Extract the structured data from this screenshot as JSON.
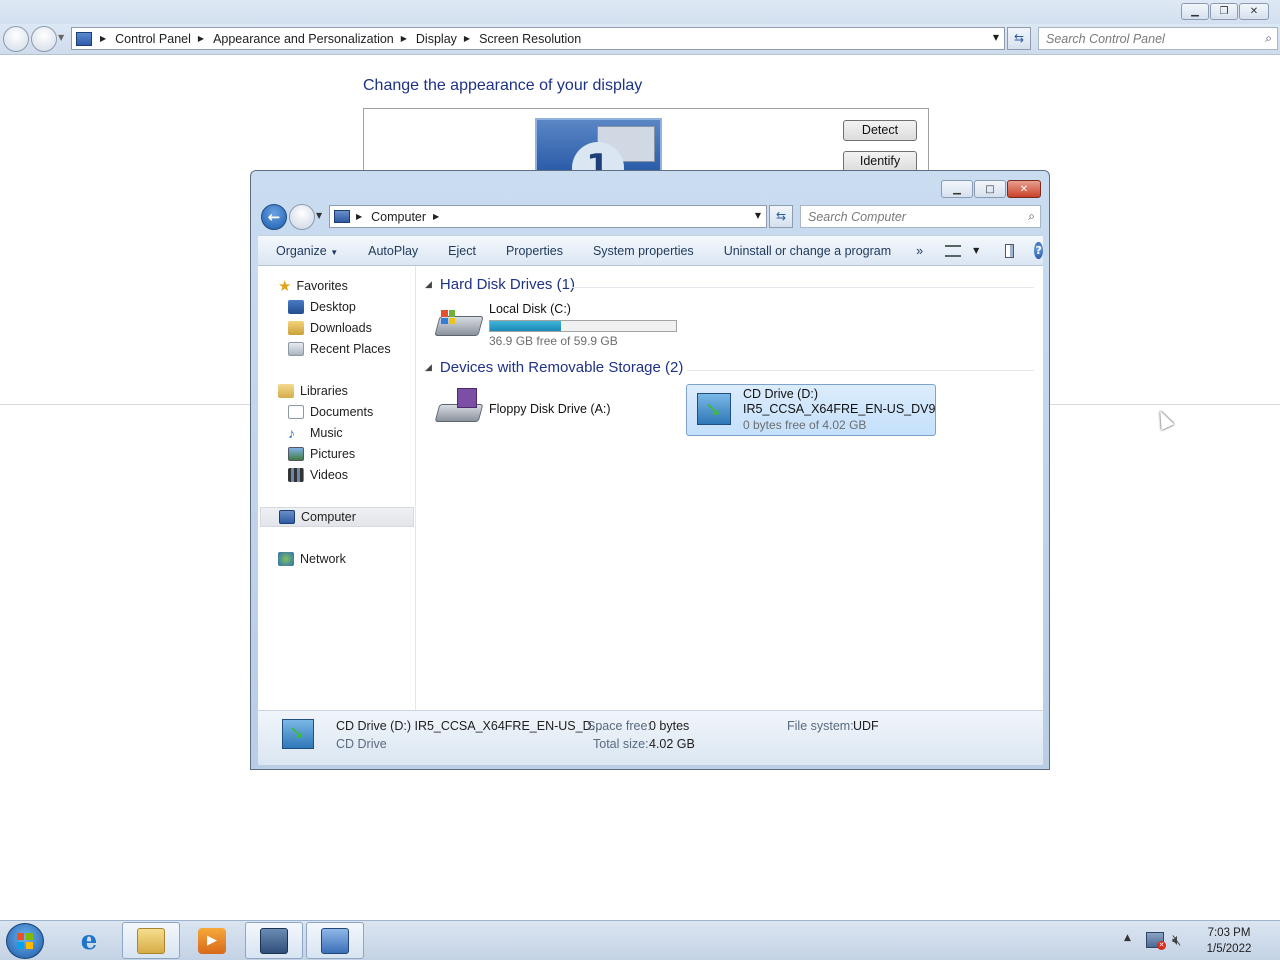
{
  "control_panel": {
    "breadcrumbs": [
      "Control Panel",
      "Appearance and Personalization",
      "Display",
      "Screen Resolution"
    ],
    "search_placeholder": "Search Control Panel",
    "heading": "Change the appearance of your display",
    "monitor_number": "1",
    "detect_label": "Detect",
    "identify_label": "Identify"
  },
  "explorer": {
    "address_location": "Computer",
    "search_placeholder": "Search Computer",
    "toolbar": {
      "organize": "Organize",
      "autoplay": "AutoPlay",
      "eject": "Eject",
      "properties": "Properties",
      "system_properties": "System properties",
      "uninstall": "Uninstall or change a program",
      "more": "»"
    },
    "nav": {
      "favorites": "Favorites",
      "desktop": "Desktop",
      "downloads": "Downloads",
      "recent_places": "Recent Places",
      "libraries": "Libraries",
      "documents": "Documents",
      "music": "Music",
      "pictures": "Pictures",
      "videos": "Videos",
      "computer": "Computer",
      "network": "Network"
    },
    "groups": {
      "hard_disk": "Hard Disk Drives (1)",
      "removable": "Devices with Removable Storage (2)"
    },
    "local_disk": {
      "name": "Local Disk (C:)",
      "free_text": "36.9 GB free of 59.9 GB",
      "used_fraction": 0.384
    },
    "floppy": {
      "name": "Floppy Disk Drive (A:)"
    },
    "cd_drive": {
      "name": "CD Drive (D:)",
      "label": "IR5_CCSA_X64FRE_EN-US_DV9",
      "free_text": "0 bytes free of 4.02 GB"
    },
    "details": {
      "title": "CD Drive (D:) IR5_CCSA_X64FRE_EN-US_D...",
      "type": "CD Drive",
      "space_free_label": "Space free:",
      "space_free_value": "0 bytes",
      "total_size_label": "Total size:",
      "total_size_value": "4.02 GB",
      "file_system_label": "File system:",
      "file_system_value": "UDF"
    }
  },
  "taskbar": {
    "time": "7:03 PM",
    "date": "1/5/2022"
  },
  "colors": {
    "link_blue": "#1e3287",
    "selection": "#c4e0fb",
    "progress": "#1a8ab8"
  }
}
